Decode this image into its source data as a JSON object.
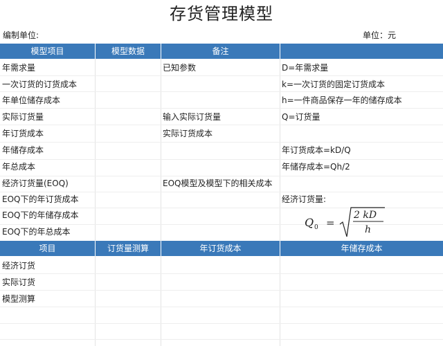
{
  "title": "存货管理模型",
  "unit_left": "编制单位:",
  "unit_right": "单位：元",
  "header1": [
    "模型项目",
    "模型数据",
    "备注",
    ""
  ],
  "rows1": [
    {
      "item": "年需求量",
      "note": "已知参数",
      "formula": "D=年需求量"
    },
    {
      "item": "一次订货的订货成本",
      "note": "",
      "formula": "k=一次订货的固定订货成本"
    },
    {
      "item": "年单位储存成本",
      "note": "",
      "formula": "h=一件商品保存一年的储存成本"
    },
    {
      "item": "实际订货量",
      "note": "输入实际订货量",
      "formula": "Q=订货量"
    },
    {
      "item": "年订货成本",
      "note": "实际订货成本",
      "formula": ""
    },
    {
      "item": "年储存成本",
      "note": "",
      "formula": "年订货成本=kD/Q"
    },
    {
      "item": "年总成本",
      "note": "",
      "formula": "年储存成本=Qh/2"
    },
    {
      "item": "经济订货量(EOQ)",
      "note": "EOQ模型及模型下的相关成本",
      "formula": ""
    },
    {
      "item": "EOQ下的年订货成本",
      "note": "",
      "formula": "经济订货量:"
    },
    {
      "item": "EOQ下的年储存成本",
      "note": "",
      "formula": ""
    },
    {
      "item": "EOQ下的年总成本",
      "note": "",
      "formula": ""
    }
  ],
  "eoq_formula": {
    "lhs": "Q",
    "sub": "0",
    "eq": "=",
    "num": "2 kD",
    "den": "h"
  },
  "header2": [
    "项目",
    "订货量测算",
    "年订货成本",
    "年储存成本"
  ],
  "rows2": [
    "经济订货",
    "实际订货",
    "模型测算"
  ]
}
